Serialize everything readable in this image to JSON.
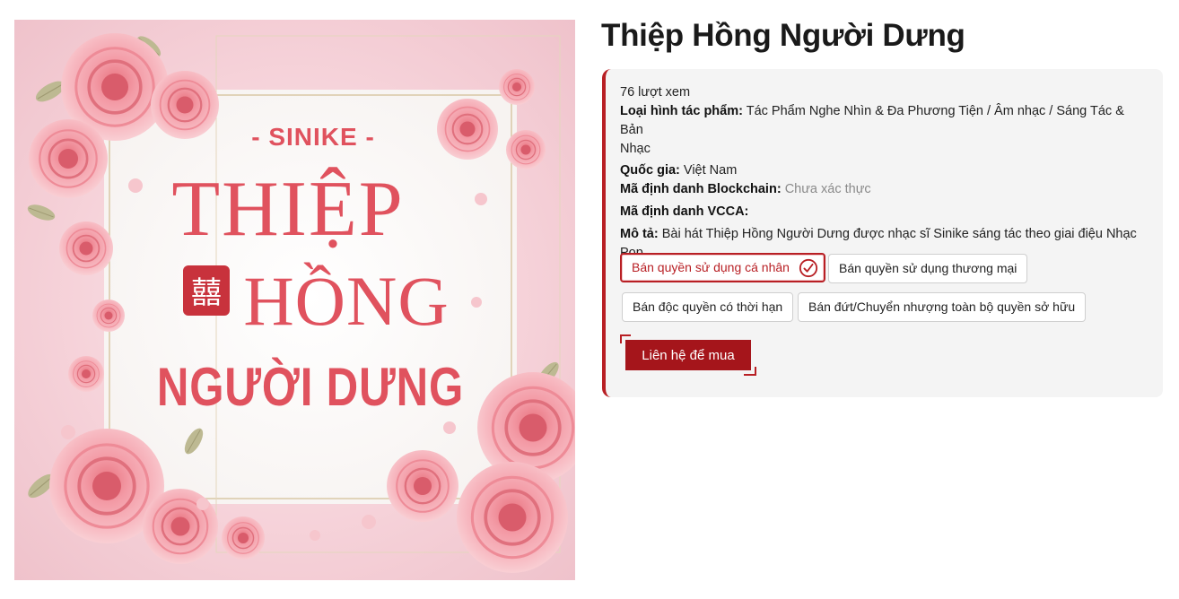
{
  "artwork": {
    "kicker": "- SINIKE -",
    "word1": "THIỆP",
    "word2": "HỒNG",
    "word3": "NGƯỜI DƯNG",
    "seal_char": "囍",
    "colors": {
      "title_red": "#e0525e",
      "rose_pink": "#f4a3ae",
      "rose_dark": "#e0737f",
      "leaf": "#b9b58f",
      "frame_gold": "#d9c8a6"
    }
  },
  "product": {
    "title": "Thiệp Hồng Người Dưng",
    "views": "76 lượt xem",
    "type_label": "Loại hình tác phẩm:",
    "type_value": "Tác Phẩm Nghe Nhìn & Đa Phương Tiện / Âm nhạc / Sáng Tác & Bản",
    "type_value_2": "Nhạc",
    "country_label": "Quốc gia:",
    "country_value": "Việt Nam",
    "blockchain_label": "Mã định danh Blockchain:",
    "blockchain_value": "Chưa xác thực",
    "vcca_label": "Mã định danh VCCA:",
    "desc_label": "Mô tả:",
    "desc_value": "Bài hát Thiệp Hồng Người Dưng được nhạc sĩ Sinike sáng tác theo giai điệu Nhạc",
    "desc_value_2": "Pop"
  },
  "licenses": [
    {
      "label": "Bán quyền sử dụng cá nhân",
      "selected": true
    },
    {
      "label": "Bán quyền sử dụng thương mại",
      "selected": false
    },
    {
      "label": "Bán độc quyền có thời hạn",
      "selected": false
    },
    {
      "label": "Bán đứt/Chuyển nhượng toàn bộ quyền sở hữu",
      "selected": false
    }
  ],
  "buy_button": {
    "label": "Liên hệ để mua"
  },
  "accent_color": "#b81f24",
  "icons": {
    "selected": "check-circle-icon"
  }
}
